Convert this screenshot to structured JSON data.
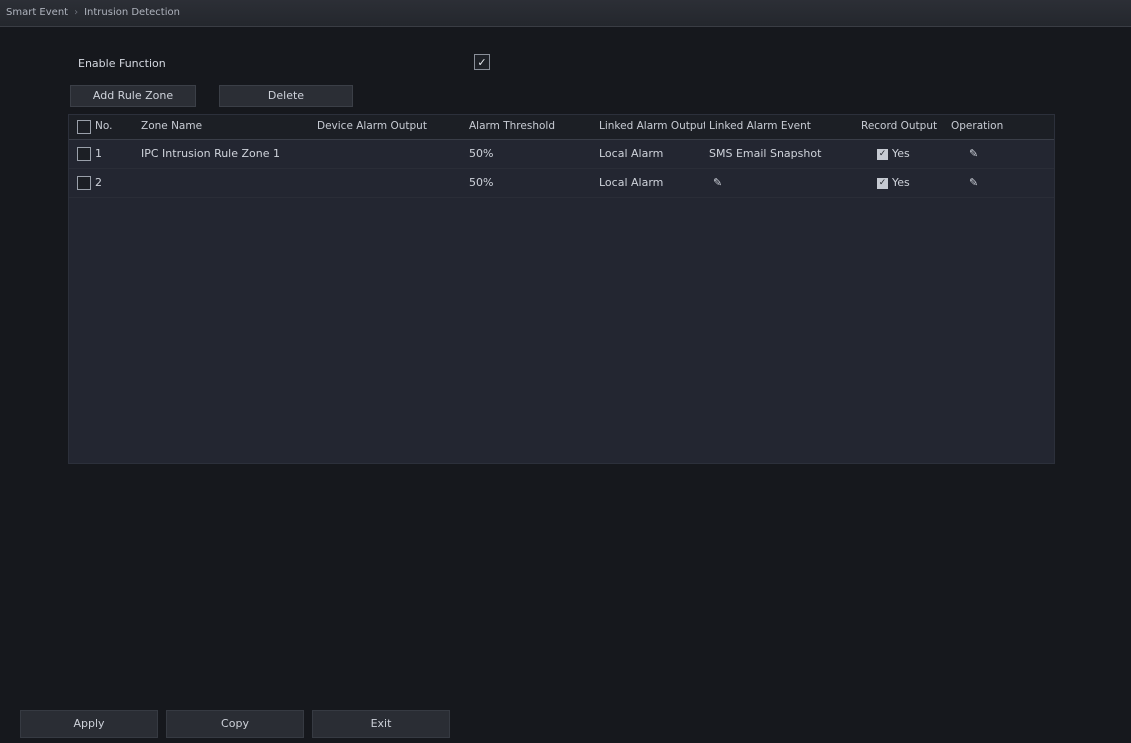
{
  "breadcrumb": [
    "Smart Event",
    "Intrusion Detection"
  ],
  "settings": {
    "enable_label": "Enable Function",
    "enable_checked_symbol": "✓"
  },
  "toolbar": {
    "add_zone_label": "Add Rule Zone",
    "delete_label": "Delete"
  },
  "table": {
    "headers": [
      "No.",
      "Zone Name",
      "Device Alarm Output",
      "Alarm Threshold",
      "Linked Alarm Output",
      "Linked Alarm Event",
      "Record Output",
      "Operation"
    ],
    "rows": [
      {
        "no": "1",
        "name": "IPC Intrusion Rule Zone 1",
        "alarm_output": "",
        "threshold": "50%",
        "linked_output": "Local Alarm",
        "linked_event": "SMS Email Snapshot",
        "record": "Yes"
      },
      {
        "no": "2",
        "name": "",
        "alarm_output": "",
        "threshold": "50%",
        "linked_output": "Local Alarm",
        "linked_event": "",
        "record": "Yes"
      }
    ]
  },
  "footer": {
    "apply_label": "Apply",
    "copy_label": "Copy",
    "exit_label": "Exit"
  },
  "icons": {
    "edit": "edit-icon"
  }
}
